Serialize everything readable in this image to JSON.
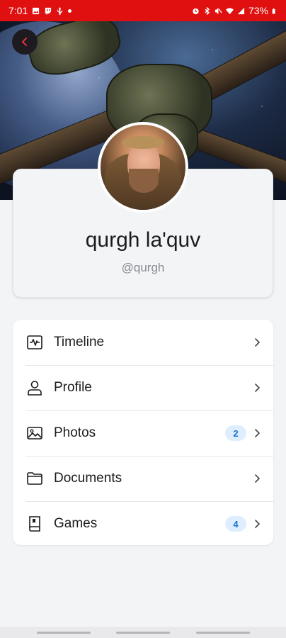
{
  "status_bar": {
    "time": "7:01",
    "battery": "73%"
  },
  "profile": {
    "display_name": "qurgh la'quv",
    "handle": "@qurgh"
  },
  "menu": {
    "items": [
      {
        "label": "Timeline",
        "icon": "timeline-icon",
        "badge": ""
      },
      {
        "label": "Profile",
        "icon": "person-icon",
        "badge": ""
      },
      {
        "label": "Photos",
        "icon": "photo-icon",
        "badge": "2"
      },
      {
        "label": "Documents",
        "icon": "folder-icon",
        "badge": ""
      },
      {
        "label": "Games",
        "icon": "book-icon",
        "badge": "4"
      }
    ]
  },
  "colors": {
    "status_bar": "#e01010",
    "badge_bg": "#dfeefe",
    "badge_text": "#1572d3",
    "back_arrow": "#e3303a"
  }
}
